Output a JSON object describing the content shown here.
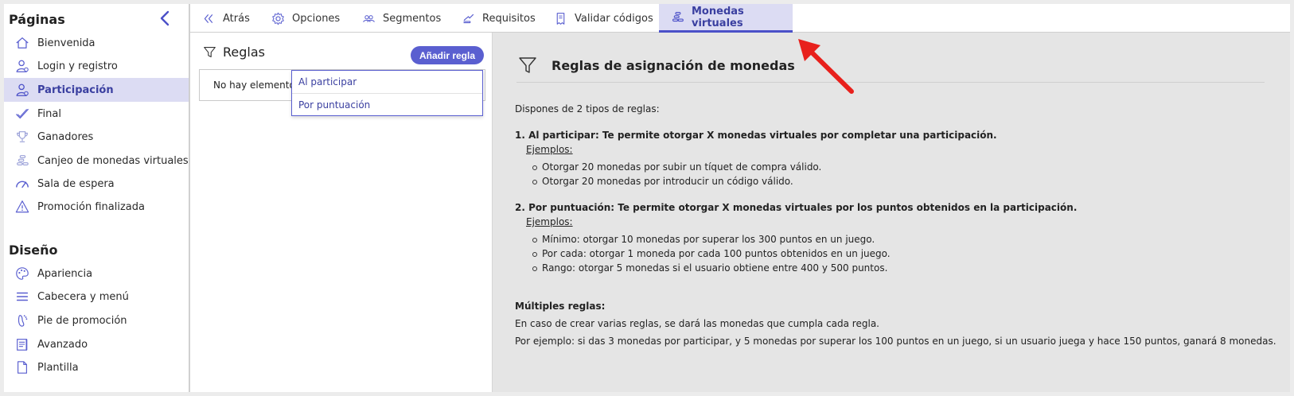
{
  "sidebar": {
    "pages_heading": "Páginas",
    "design_heading": "Diseño",
    "pages_items": [
      {
        "label": "Bienvenida",
        "icon": "home-icon"
      },
      {
        "label": "Login y registro",
        "icon": "user-login-icon"
      },
      {
        "label": "Participación",
        "icon": "user-participation-icon",
        "active": true
      },
      {
        "label": "Final",
        "icon": "check-icon"
      },
      {
        "label": "Ganadores",
        "icon": "trophy-icon"
      },
      {
        "label": "Canjeo de monedas virtuales",
        "icon": "coins-icon"
      },
      {
        "label": "Sala de espera",
        "icon": "gauge-icon"
      },
      {
        "label": "Promoción finalizada",
        "icon": "warning-icon"
      }
    ],
    "design_items": [
      {
        "label": "Apariencia",
        "icon": "palette-icon"
      },
      {
        "label": "Cabecera y menú",
        "icon": "menu-icon"
      },
      {
        "label": "Pie de promoción",
        "icon": "foot-icon"
      },
      {
        "label": "Avanzado",
        "icon": "advanced-icon"
      },
      {
        "label": "Plantilla",
        "icon": "template-icon"
      }
    ]
  },
  "tabs": [
    {
      "label": "Atrás",
      "icon": "double-chevron-left-icon"
    },
    {
      "label": "Opciones",
      "icon": "gear-icon"
    },
    {
      "label": "Segmentos",
      "icon": "users-icon"
    },
    {
      "label": "Requisitos",
      "icon": "hand-icon"
    },
    {
      "label": "Validar códigos",
      "icon": "ticket-icon"
    },
    {
      "label": "Monedas virtuales",
      "icon": "coins-icon",
      "active": true
    }
  ],
  "rules_panel": {
    "title": "Reglas",
    "add_button": "Añadir regla",
    "empty_text": "No hay elementos",
    "dropdown": [
      "Al participar",
      "Por puntuación"
    ]
  },
  "help": {
    "title": "Reglas de asignación de monedas",
    "intro": "Dispones de 2 tipos de reglas:",
    "rule1_title": "1. Al participar: Te permite otorgar X monedas virtuales por completar una participación.",
    "examples_label": "Ejemplos:",
    "rule1_examples": [
      "Otorgar 20 monedas por subir un tíquet de compra válido.",
      "Otorgar 20 monedas por introducir un código válido."
    ],
    "rule2_title": "2. Por puntuación: Te permite otorgar X monedas virtuales por los puntos obtenidos en la participación.",
    "rule2_examples": [
      "Mínimo: otorgar 10 monedas por superar los 300 puntos en un juego.",
      "Por cada: otorgar 1 moneda por cada 100 puntos obtenidos en un juego.",
      "Rango: otorgar 5 monedas si el usuario obtiene entre 400 y 500 puntos."
    ],
    "multiple_title": "Múltiples reglas:",
    "multiple_text1": "En caso de crear varias reglas, se dará las monedas que cumpla cada regla.",
    "multiple_text2": "Por ejemplo: si das 3 monedas por participar, y 5 monedas por superar los 100 puntos en un juego, si un usuario juega y hace 150 puntos, ganará 8 monedas."
  },
  "colors": {
    "accent": "#4b50c8",
    "active_bg": "#dcdcf3",
    "arrow": "#e8201c"
  }
}
